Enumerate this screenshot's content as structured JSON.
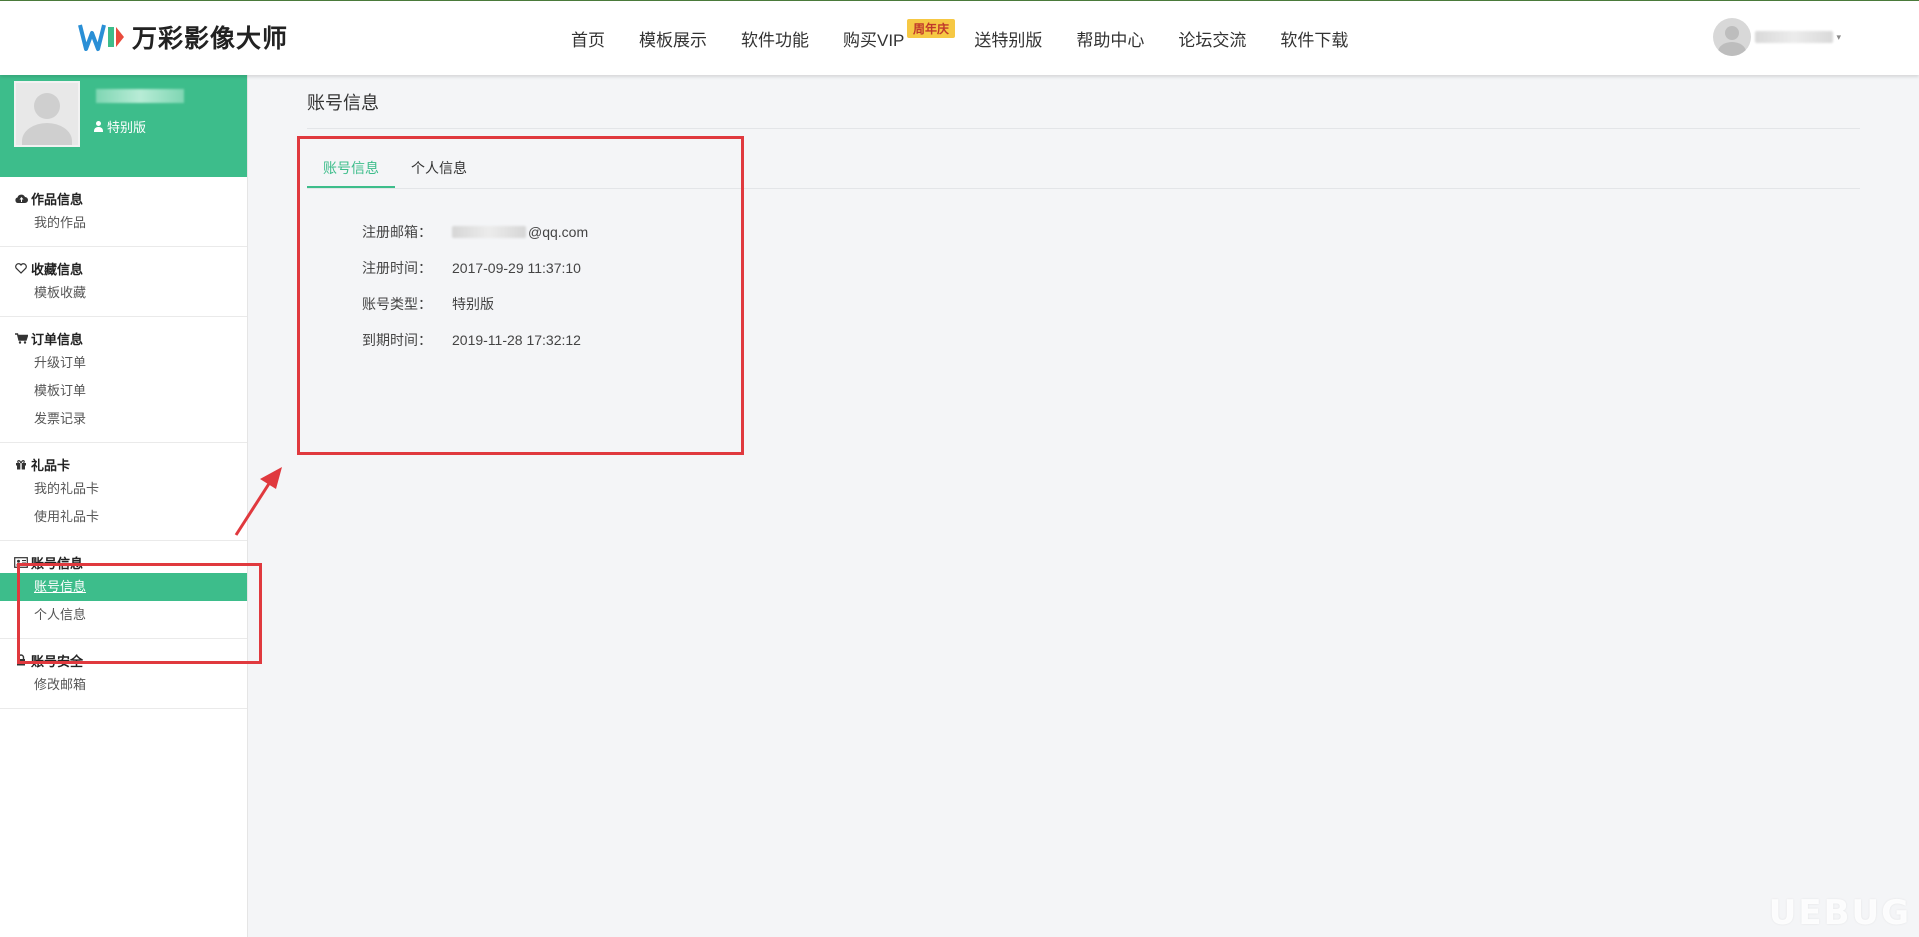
{
  "header": {
    "logo_text": "万彩影像大师",
    "nav": [
      {
        "label": "首页"
      },
      {
        "label": "模板展示"
      },
      {
        "label": "软件功能"
      },
      {
        "label": "购买VIP",
        "badge": "周年庆"
      },
      {
        "label": "送特别版"
      },
      {
        "label": "帮助中心"
      },
      {
        "label": "论坛交流"
      },
      {
        "label": "软件下载"
      }
    ],
    "user_caret": "▾"
  },
  "sidebar": {
    "profile_tier": "特别版",
    "groups": [
      {
        "title": "作品信息",
        "icon": "cloud-upload-icon",
        "items": [
          "我的作品"
        ]
      },
      {
        "title": "收藏信息",
        "icon": "heart-icon",
        "items": [
          "模板收藏"
        ]
      },
      {
        "title": "订单信息",
        "icon": "cart-icon",
        "items": [
          "升级订单",
          "模板订单",
          "发票记录"
        ]
      },
      {
        "title": "礼品卡",
        "icon": "gift-icon",
        "items": [
          "我的礼品卡",
          "使用礼品卡"
        ]
      },
      {
        "title": "账号信息",
        "icon": "id-card-icon",
        "items": [
          "账号信息",
          "个人信息"
        ],
        "active_item": 0
      },
      {
        "title": "账号安全",
        "icon": "lock-icon",
        "items": [
          "修改邮箱"
        ]
      }
    ]
  },
  "main": {
    "title": "账号信息",
    "tabs": [
      {
        "label": "账号信息",
        "active": true
      },
      {
        "label": "个人信息",
        "active": false
      }
    ],
    "info": [
      {
        "label": "注册邮箱：",
        "value": "@qq.com",
        "blurred_prefix": true
      },
      {
        "label": "注册时间：",
        "value": "2017-09-29 11:37:10"
      },
      {
        "label": "账号类型：",
        "value": "特别版"
      },
      {
        "label": "到期时间：",
        "value": "2019-11-28 17:32:12"
      }
    ]
  },
  "colors": {
    "accent": "#3dbd8b",
    "annotation": "#e0393e",
    "badge_bg": "#f6c844"
  },
  "watermark": "UEBUG"
}
